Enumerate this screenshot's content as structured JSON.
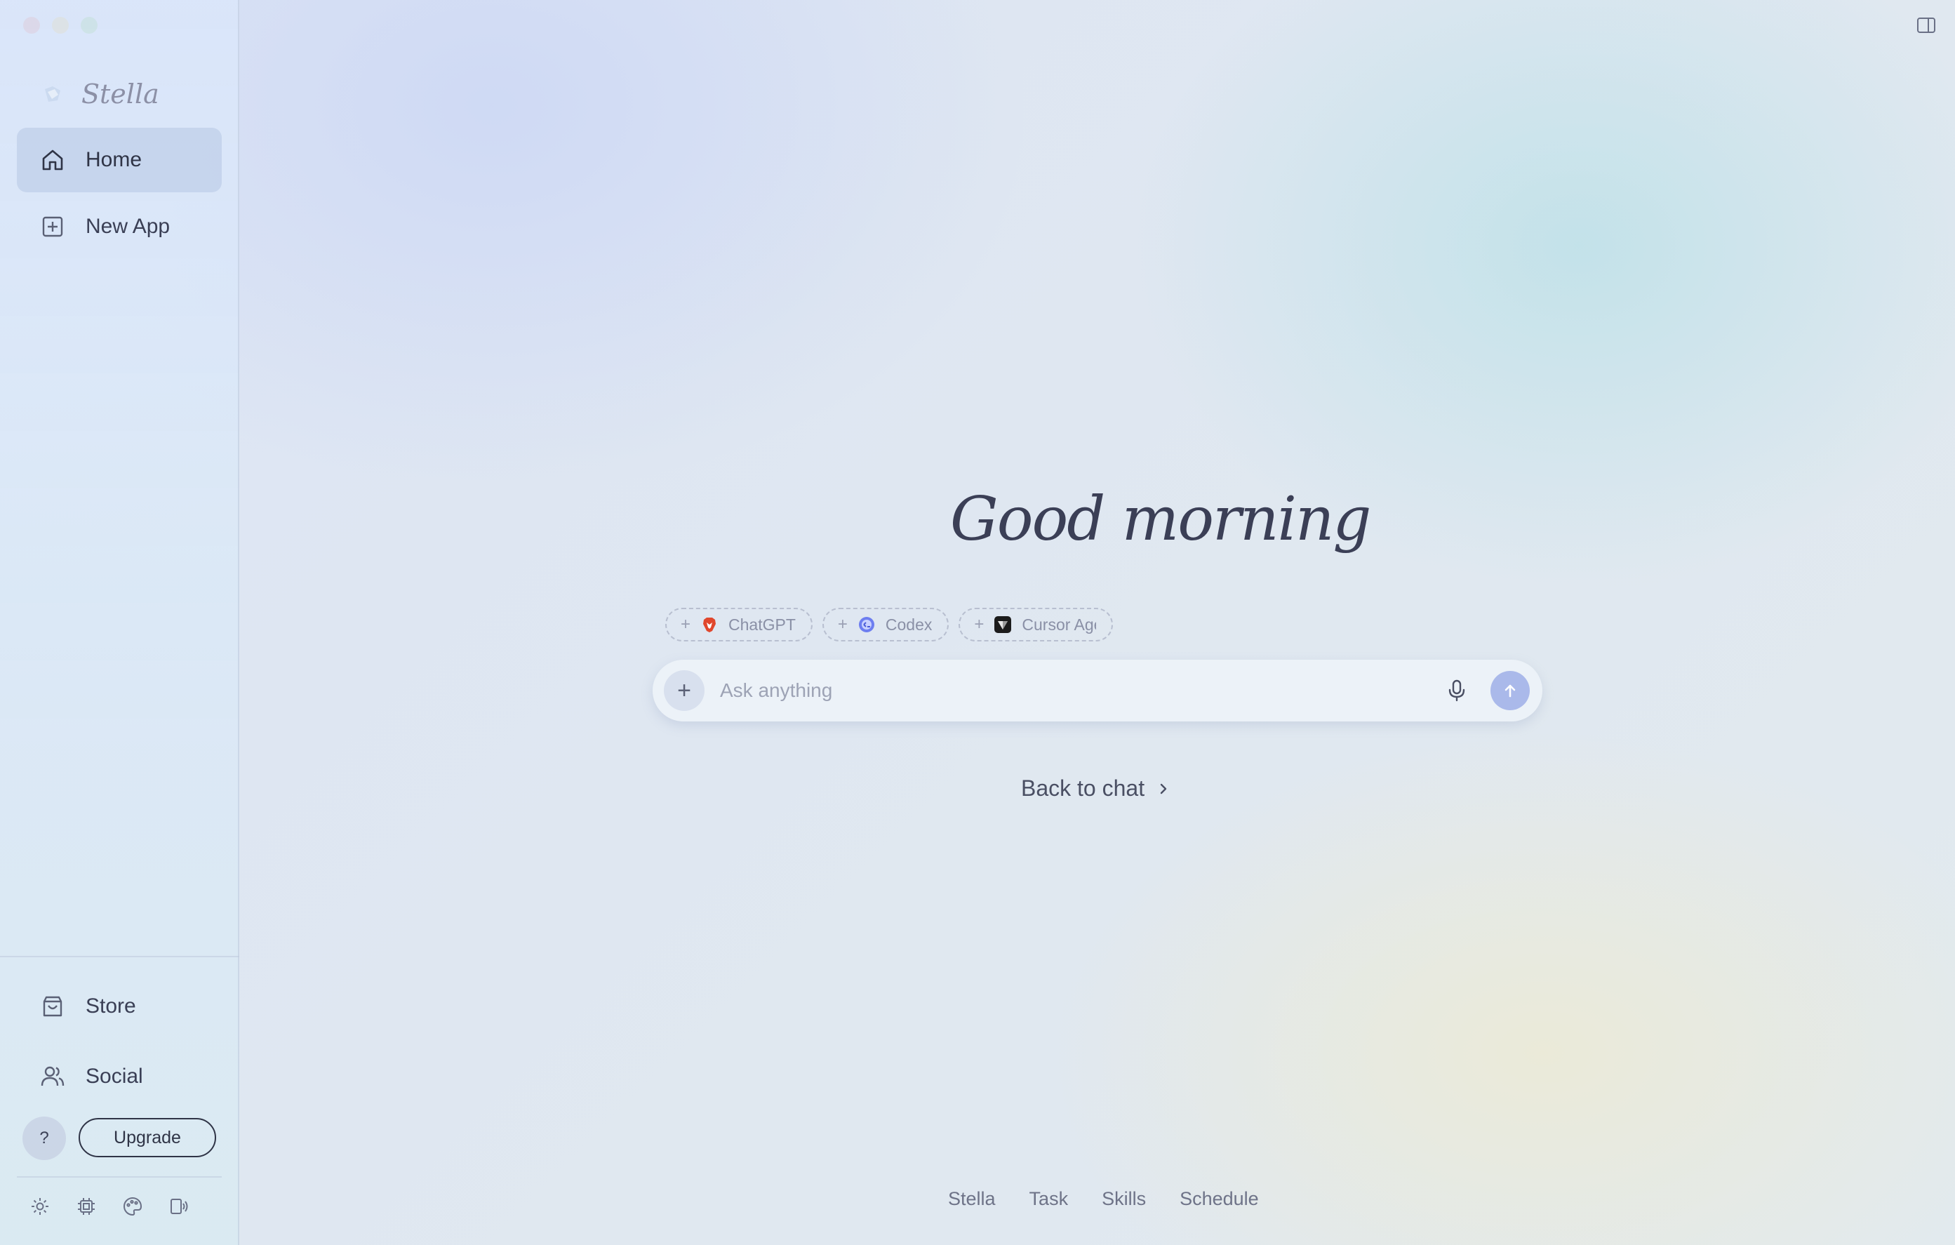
{
  "app": {
    "brand_name": "Stella"
  },
  "sidebar": {
    "items": [
      {
        "label": "Home",
        "icon": "home-icon",
        "active": true
      },
      {
        "label": "New App",
        "icon": "plus-square-icon"
      }
    ],
    "bottom_items": [
      {
        "label": "Store",
        "icon": "shopping-bag-icon"
      },
      {
        "label": "Social",
        "icon": "users-icon"
      }
    ],
    "help_label": "?",
    "upgrade_label": "Upgrade",
    "tools": [
      "gear-icon",
      "chip-icon",
      "palette-icon",
      "device-audio-icon"
    ]
  },
  "main": {
    "greeting": "Good morning",
    "chips": [
      {
        "label": "ChatGPT",
        "icon": "brave-lion-icon",
        "color": "#e0472d"
      },
      {
        "label": "Codex",
        "icon": "codex-globe-icon",
        "color": "#4a5bd8"
      },
      {
        "label": "Cursor Ager",
        "icon": "cursor-cube-icon",
        "color": "#1c1c1c"
      }
    ],
    "composer": {
      "placeholder": "Ask anything",
      "add_label": "+"
    },
    "back_link": "Back to chat",
    "bottom_tabs": [
      "Stella",
      "Task",
      "Skills",
      "Schedule"
    ]
  },
  "colors": {
    "accent": "#aab9ea",
    "text": "#3a3f55",
    "close": "#ee5d55",
    "minimize": "#f5bd31",
    "maximize": "#5fc444"
  }
}
